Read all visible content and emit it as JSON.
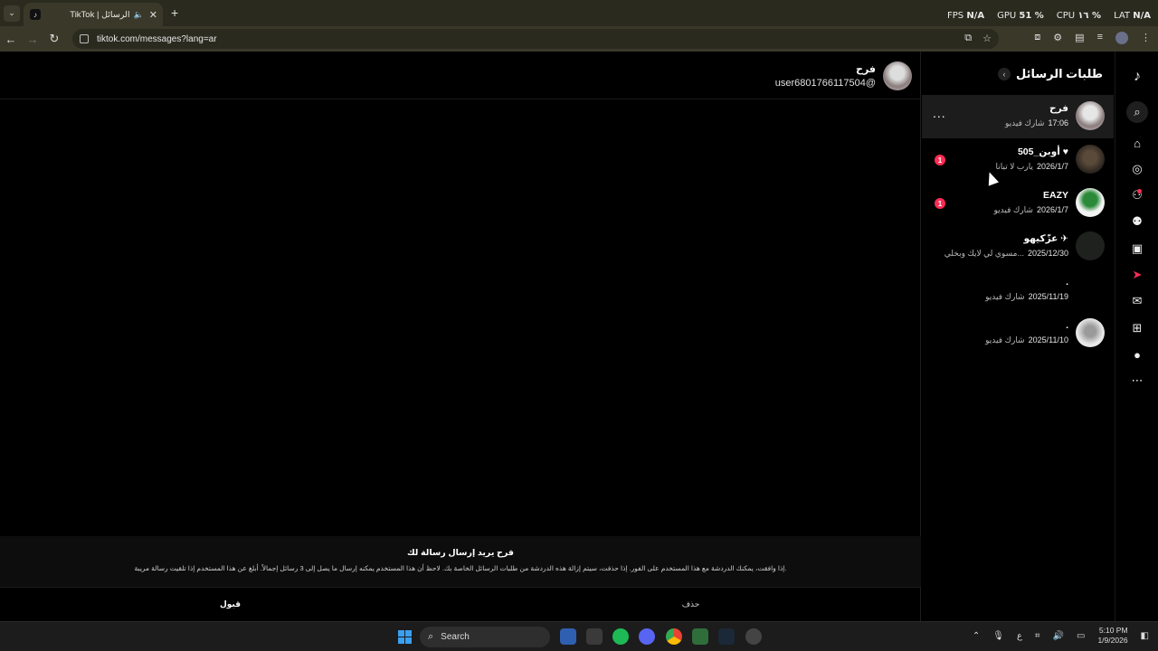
{
  "browser": {
    "tab_title": "TikTok | الرسائل",
    "tab_close": "✕",
    "new_tab": "+",
    "url": "tiktok.com/messages?lang=ar"
  },
  "hud": {
    "fps_label": "FPS",
    "fps_value": "N/A",
    "gpu_label": "GPU",
    "gpu_value": "51 %",
    "cpu_label": "CPU",
    "cpu_value": "١٦ %",
    "lat_label": "LAT",
    "lat_value": "N/A"
  },
  "chat": {
    "name": "فرح",
    "username": "user6801766117504@",
    "request_title": "فرح يريد إرسال رسالة لك",
    "request_desc": "إذا وافقت، يمكنك الدردشة مع هذا المستخدم على الفور. إذا حذفت، سيتم إزالة هذه الدردشة من طلبات الرسائل الخاصة بك. لاحظ أن هذا المستخدم يمكنه إرسال ما يصل إلى 3 رسائل إجمالاً. أبلغ عن هذا المستخدم إذا تلقيت رسالة مريبة.",
    "accept_label": "قبول",
    "delete_label": "حذف"
  },
  "list": {
    "title": "طلبات الرسائل",
    "back": "‹",
    "items": [
      {
        "name": "فرح",
        "sub": "شارك فيديو",
        "date": "17:06",
        "badge": "",
        "more": "..."
      },
      {
        "name": "أوبن_505 ♥",
        "sub": "يارب لا تبانا",
        "date": "2026/1/7",
        "badge": "1",
        "more": ""
      },
      {
        "name": "EAZY",
        "sub": "شارك فيديو",
        "date": "2026/1/7",
        "badge": "1",
        "more": ""
      },
      {
        "name": "عزّكيهو ✈",
        "sub": "مسوي لي لايك وبخلي...",
        "date": "2025/12/30",
        "badge": "",
        "more": ""
      },
      {
        "name": ".",
        "sub": "شارك فيديو",
        "date": "2025/11/19",
        "badge": "",
        "more": ""
      },
      {
        "name": ".",
        "sub": "شارك فيديو",
        "date": "2025/11/10",
        "badge": "",
        "more": ""
      }
    ]
  },
  "rail": {
    "activity_badge": "7"
  },
  "taskbar": {
    "search_label": "Search",
    "time": "5:10 PM",
    "date": "1/9/2026",
    "lang": "ع"
  }
}
